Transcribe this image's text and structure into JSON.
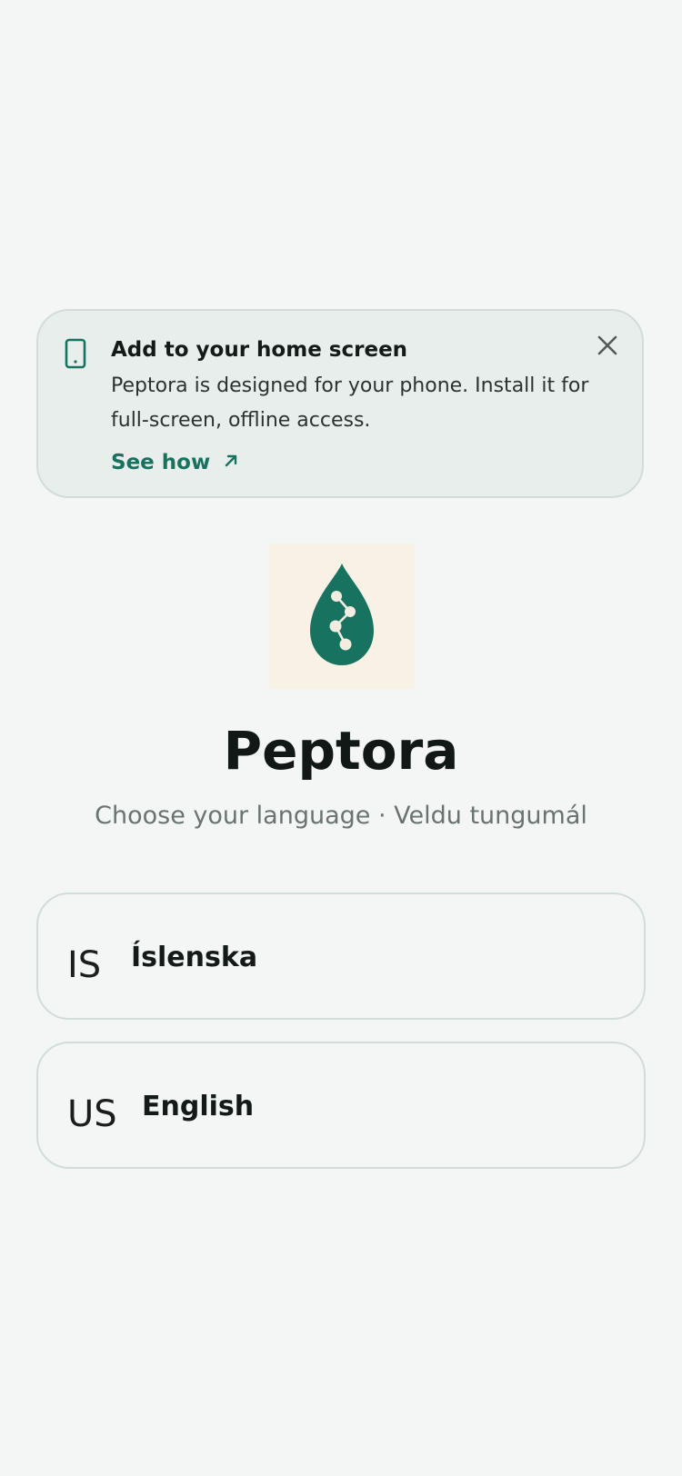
{
  "banner": {
    "title": "Add to your home screen",
    "body": "Peptora is designed for your phone. Install it for full-screen, offline access.",
    "see_how": "See how",
    "phone_icon": "phone-icon",
    "close_icon": "close-icon",
    "arrow_icon": "arrow-up-right-icon"
  },
  "app": {
    "name": "Peptora",
    "subtitle": "Choose your language · Veldu tungumál",
    "logo_icon": "droplet-molecule-icon"
  },
  "languages": [
    {
      "code": "IS",
      "label": "Íslenska"
    },
    {
      "code": "US",
      "label": "English"
    }
  ],
  "colors": {
    "accent": "#17725f",
    "background": "#f3f6f5",
    "logo_bg": "#f8f2e6"
  }
}
